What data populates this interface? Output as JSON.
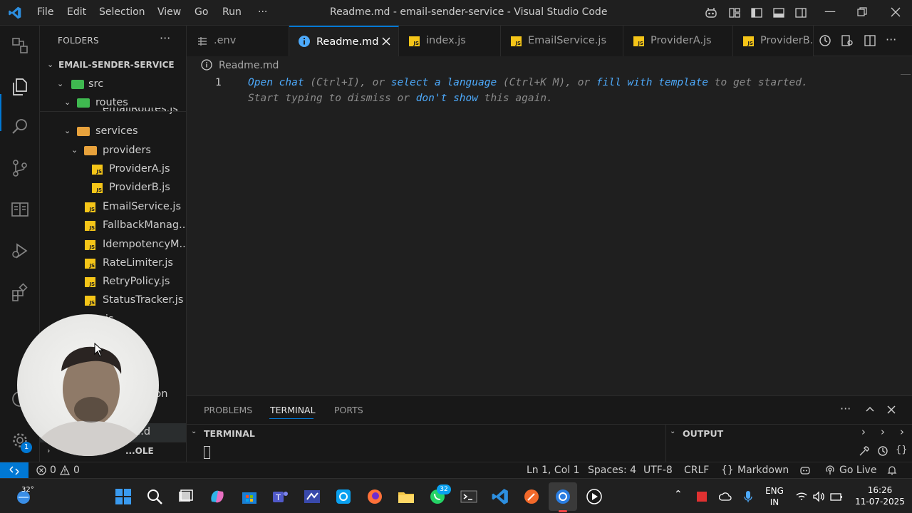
{
  "window": {
    "title": "Readme.md - email-sender-service - Visual Studio Code",
    "menu": [
      "File",
      "Edit",
      "Selection",
      "View",
      "Go",
      "Run",
      "···"
    ]
  },
  "activity_bar": {
    "icons": [
      "explorer-icon",
      "search-icon",
      "source-control-icon",
      "notes-icon",
      "run-debug-icon",
      "extensions-icon",
      "account-icon",
      "settings-gear-icon"
    ],
    "settings_badge": "1"
  },
  "sidebar": {
    "header": "FOLDERS",
    "root": "EMAIL-SENDER-SERVICE",
    "items": [
      {
        "label": "src",
        "kind": "folder"
      },
      {
        "label": "routes",
        "kind": "folder"
      },
      {
        "label": "emailRoutes.js",
        "kind": "js"
      },
      {
        "label": "services",
        "kind": "folder"
      },
      {
        "label": "providers",
        "kind": "folder"
      },
      {
        "label": "ProviderA.js",
        "kind": "js"
      },
      {
        "label": "ProviderB.js",
        "kind": "js"
      },
      {
        "label": "EmailService.js",
        "kind": "js"
      },
      {
        "label": "FallbackManag...",
        "kind": "js"
      },
      {
        "label": "IdempotencyM...",
        "kind": "js"
      },
      {
        "label": "RateLimiter.js",
        "kind": "js"
      },
      {
        "label": "RetryPolicy.js",
        "kind": "js"
      },
      {
        "label": "StatusTracker.js",
        "kind": "js"
      },
      {
        "label": "...js",
        "kind": "js"
      },
      {
        "label": "...son",
        "kind": "js"
      },
      {
        "label": "...d",
        "kind": "js"
      }
    ],
    "bottom_section": "...OLE"
  },
  "tabs": [
    {
      "label": ".env",
      "icon": "env-icon",
      "active": false
    },
    {
      "label": "Readme.md",
      "icon": "info-icon",
      "active": true
    },
    {
      "label": "index.js",
      "icon": "js-icon",
      "active": false
    },
    {
      "label": "EmailService.js",
      "icon": "js-icon",
      "active": false
    },
    {
      "label": "ProviderA.js",
      "icon": "js-icon",
      "active": false
    },
    {
      "label": "ProviderB.j",
      "icon": "js-icon",
      "active": false
    }
  ],
  "editor": {
    "breadcrumb": "Readme.md",
    "line_number": "1",
    "hint": {
      "open_chat": "Open chat",
      "open_chat_key": " (Ctrl+I), or ",
      "select_language": "select a language",
      "select_language_key": " (Ctrl+K M), or ",
      "fill_template": "fill with template",
      "tail": " to get started.",
      "line2_a": "Start typing to dismiss or ",
      "dont_show": "don't show",
      "line2_b": " this again."
    }
  },
  "panel": {
    "tabs": [
      "PROBLEMS",
      "TERMINAL",
      "PORTS"
    ],
    "active_tab": "TERMINAL",
    "left_section": "TERMINAL",
    "right_section": "OUTPUT"
  },
  "status_bar": {
    "errors": "0",
    "warnings": "0",
    "position": "Ln 1, Col 1",
    "spaces": "Spaces: 4",
    "encoding": "UTF-8",
    "eol": "CRLF",
    "language": "Markdown",
    "golive": "Go Live"
  },
  "taskbar": {
    "weather": "32°",
    "whatsapp_badge": "32",
    "language_top": "ENG",
    "language_bottom": "IN",
    "time": "16:26",
    "date": "11-07-2025"
  },
  "colors": {
    "accent": "#0078d4",
    "link": "#4daafc",
    "js_icon": "#f5c518",
    "folder_green": "#3fb950",
    "folder_orange": "#e8a23c"
  }
}
